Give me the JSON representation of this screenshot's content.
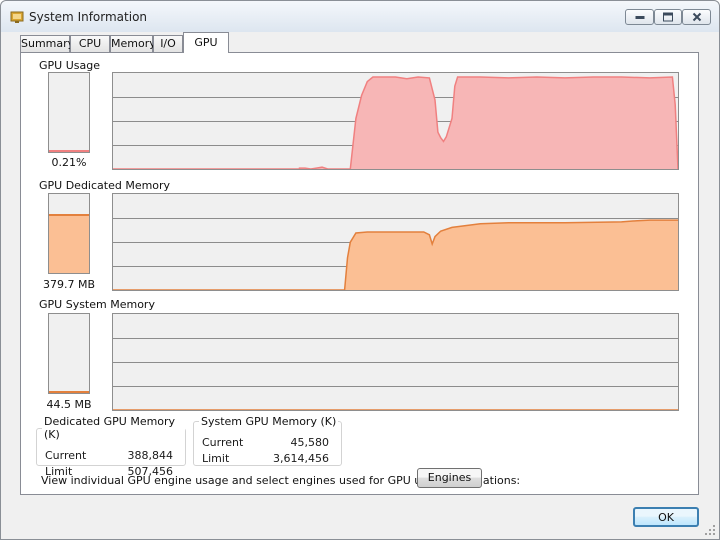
{
  "window": {
    "title": "System Information"
  },
  "tabs": [
    {
      "label": "Summary"
    },
    {
      "label": "CPU"
    },
    {
      "label": "Memory"
    },
    {
      "label": "I/O"
    },
    {
      "label": "GPU"
    }
  ],
  "active_tab": "GPU",
  "sections": {
    "gpu_usage": {
      "label": "GPU Usage",
      "meter_value": "0.21%",
      "meter_fraction": 0.0021,
      "color": "#f7b6b6",
      "line_color": "#f08080"
    },
    "dedicated": {
      "label": "GPU Dedicated Memory",
      "meter_value": "379.7 MB",
      "meter_fraction": 0.75,
      "color": "#fbbf94",
      "line_color": "#e3803d"
    },
    "system": {
      "label": "GPU System Memory",
      "meter_value": "44.5 MB",
      "meter_fraction": 0.012,
      "color": "#fbbf94",
      "line_color": "#e3803d"
    }
  },
  "dedicated_box": {
    "title": "Dedicated GPU Memory (K)",
    "rows": [
      {
        "label": "Current",
        "value": "388,844"
      },
      {
        "label": "Limit",
        "value": "507,456"
      }
    ]
  },
  "system_box": {
    "title": "System GPU Memory (K)",
    "rows": [
      {
        "label": "Current",
        "value": "45,580"
      },
      {
        "label": "Limit",
        "value": "3,614,456"
      }
    ]
  },
  "engines": {
    "description": "View individual GPU engine usage and select engines used for GPU usage calculations:",
    "button_label": "Engines"
  },
  "ok_label": "OK",
  "graphs": {
    "gpu_usage": [
      [
        0,
        0
      ],
      [
        0.33,
        0
      ],
      [
        0.33,
        0.01
      ],
      [
        0.34,
        0.01
      ],
      [
        0.35,
        0
      ],
      [
        0.36,
        0.01
      ],
      [
        0.37,
        0.02
      ],
      [
        0.38,
        0
      ],
      [
        0.42,
        0
      ],
      [
        0.43,
        0.55
      ],
      [
        0.44,
        0.8
      ],
      [
        0.45,
        0.95
      ],
      [
        0.46,
        1
      ],
      [
        0.5,
        1
      ],
      [
        0.52,
        0.98
      ],
      [
        0.54,
        1
      ],
      [
        0.56,
        0.99
      ],
      [
        0.57,
        0.75
      ],
      [
        0.575,
        0.4
      ],
      [
        0.58,
        0.34
      ],
      [
        0.585,
        0.3
      ],
      [
        0.59,
        0.35
      ],
      [
        0.6,
        0.55
      ],
      [
        0.605,
        0.9
      ],
      [
        0.61,
        1
      ],
      [
        0.65,
        1
      ],
      [
        0.7,
        0.99
      ],
      [
        0.75,
        1
      ],
      [
        0.8,
        0.99
      ],
      [
        0.85,
        1
      ],
      [
        0.9,
        1
      ],
      [
        0.95,
        0.99
      ],
      [
        0.99,
        1
      ],
      [
        0.995,
        0.7
      ],
      [
        1,
        0
      ]
    ],
    "dedicated": [
      [
        0,
        0
      ],
      [
        0.41,
        0
      ],
      [
        0.415,
        0.35
      ],
      [
        0.42,
        0.52
      ],
      [
        0.43,
        0.62
      ],
      [
        0.45,
        0.63
      ],
      [
        0.5,
        0.63
      ],
      [
        0.55,
        0.63
      ],
      [
        0.56,
        0.6
      ],
      [
        0.565,
        0.5
      ],
      [
        0.57,
        0.58
      ],
      [
        0.58,
        0.64
      ],
      [
        0.6,
        0.68
      ],
      [
        0.65,
        0.72
      ],
      [
        0.7,
        0.73
      ],
      [
        0.75,
        0.73
      ],
      [
        0.8,
        0.73
      ],
      [
        0.9,
        0.74
      ],
      [
        0.92,
        0.75
      ],
      [
        0.95,
        0.76
      ],
      [
        1,
        0.76
      ]
    ],
    "system": [
      [
        0,
        0
      ],
      [
        1,
        0
      ]
    ]
  }
}
